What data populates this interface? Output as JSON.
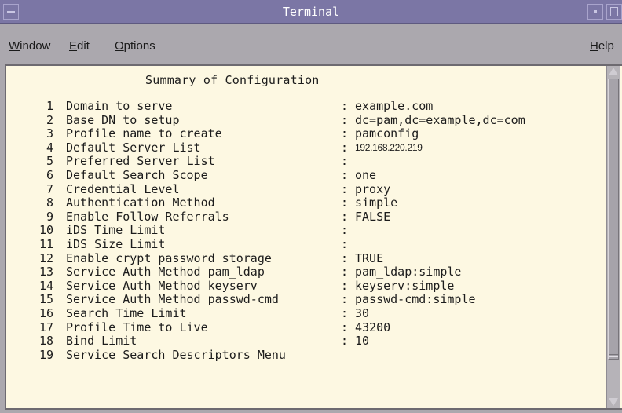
{
  "window": {
    "title": "Terminal"
  },
  "menubar": {
    "items": [
      {
        "key": "W",
        "rest": "indow"
      },
      {
        "key": "E",
        "rest": "dit"
      },
      {
        "key": "O",
        "rest": "ptions"
      }
    ],
    "help": {
      "key": "H",
      "rest": "elp"
    }
  },
  "terminal": {
    "heading": "Summary of Configuration",
    "separator": ":",
    "rows": [
      {
        "num": "1",
        "label": "Domain to serve",
        "value": "example.com"
      },
      {
        "num": "2",
        "label": "Base DN to setup",
        "value": "dc=pam,dc=example,dc=com"
      },
      {
        "num": "3",
        "label": "Profile name to create",
        "value": "pamconfig"
      },
      {
        "num": "4",
        "label": "Default Server List",
        "value": "192.168.220.219"
      },
      {
        "num": "5",
        "label": "Preferred Server List",
        "value": ""
      },
      {
        "num": "6",
        "label": "Default Search Scope",
        "value": "one"
      },
      {
        "num": "7",
        "label": "Credential Level",
        "value": "proxy"
      },
      {
        "num": "8",
        "label": "Authentication Method",
        "value": "simple"
      },
      {
        "num": "9",
        "label": "Enable Follow Referrals",
        "value": "FALSE"
      },
      {
        "num": "10",
        "label": "iDS Time Limit",
        "value": ""
      },
      {
        "num": "11",
        "label": "iDS Size Limit",
        "value": ""
      },
      {
        "num": "12",
        "label": "Enable crypt password storage",
        "value": "TRUE"
      },
      {
        "num": "13",
        "label": "Service Auth Method pam_ldap",
        "value": "pam_ldap:simple"
      },
      {
        "num": "14",
        "label": "Service Auth Method keyserv",
        "value": "keyserv:simple"
      },
      {
        "num": "15",
        "label": "Service Auth Method passwd-cmd",
        "value": "passwd-cmd:simple"
      },
      {
        "num": "16",
        "label": "Search Time Limit",
        "value": "30"
      },
      {
        "num": "17",
        "label": "Profile Time to Live",
        "value": "43200"
      },
      {
        "num": "18",
        "label": "Bind Limit",
        "value": "10"
      },
      {
        "num": "19",
        "label": "Service Search Descriptors Menu",
        "value": ""
      }
    ]
  },
  "icons": {
    "window_menu": "window-menu-icon",
    "minimize": "minimize-icon",
    "maximize": "maximize-icon",
    "scroll_up": "arrow-up-icon",
    "scroll_down": "arrow-down-icon"
  },
  "colors": {
    "titlebar": "#7b76a5",
    "terminal_bg": "#fdf8e2",
    "chrome": "#aba8ae"
  }
}
